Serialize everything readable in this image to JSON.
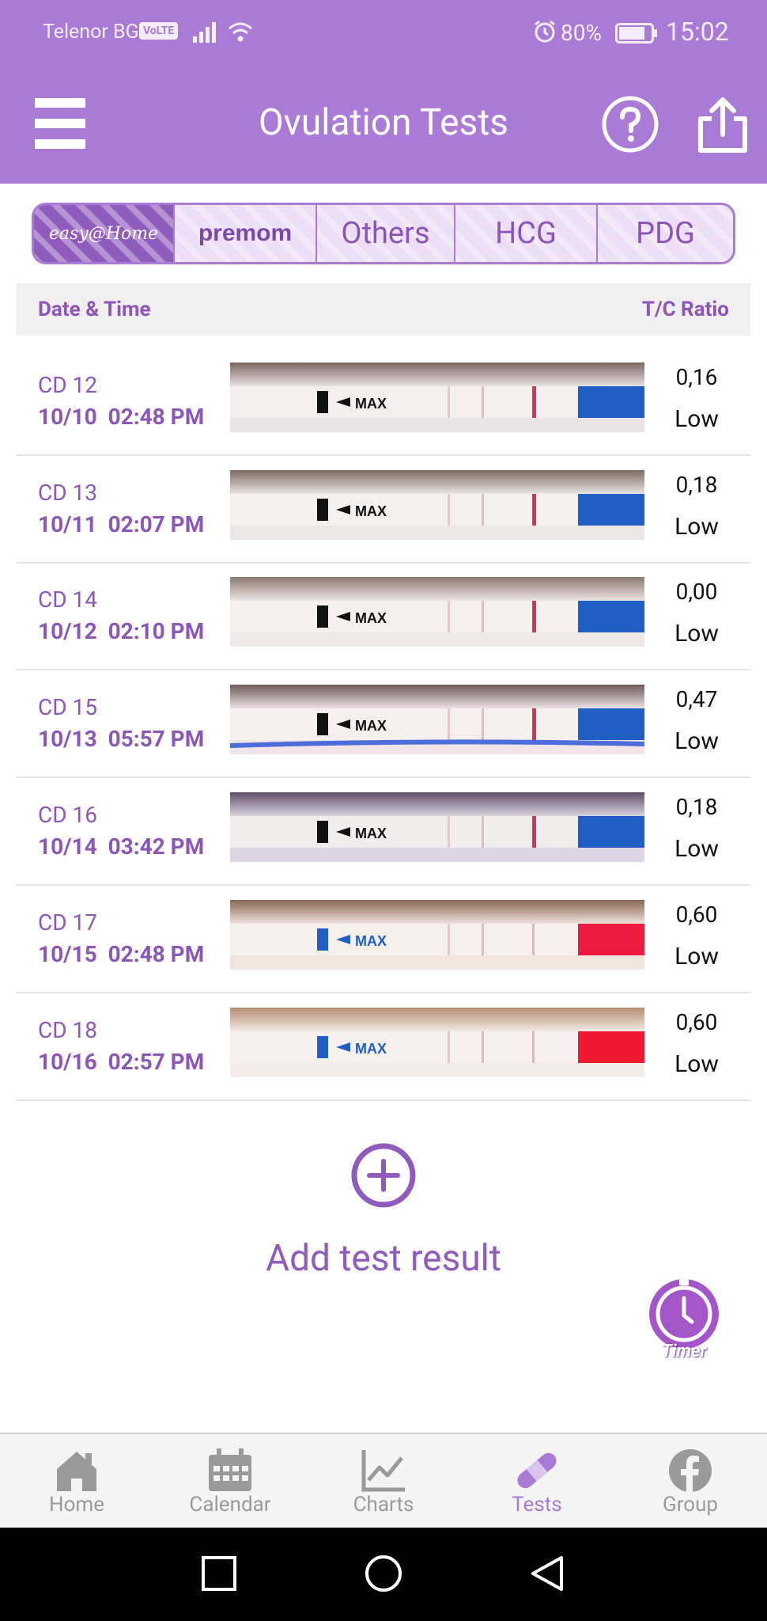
{
  "status_bar": {
    "carrier": "Telenor BG",
    "volte": "VoLTE",
    "battery": "80%",
    "time": "15:02"
  },
  "app_bar": {
    "title": "Ovulation Tests"
  },
  "brand_tabs": [
    {
      "label": "easy@Home",
      "active": true
    },
    {
      "label": "premom",
      "active": false
    },
    {
      "label": "Others",
      "active": false
    },
    {
      "label": "HCG",
      "active": false
    },
    {
      "label": "PDG",
      "active": false
    }
  ],
  "table": {
    "headers": {
      "left": "Date & Time",
      "right": "T/C Ratio"
    },
    "rows": [
      {
        "cd": "CD 12",
        "date": "10/10",
        "time": "02:48 PM",
        "ratio": "0,16",
        "level": "Low"
      },
      {
        "cd": "CD 13",
        "date": "10/11",
        "time": "02:07 PM",
        "ratio": "0,18",
        "level": "Low"
      },
      {
        "cd": "CD 14",
        "date": "10/12",
        "time": "02:10 PM",
        "ratio": "0,00",
        "level": "Low"
      },
      {
        "cd": "CD 15",
        "date": "10/13",
        "time": "05:57 PM",
        "ratio": "0,47",
        "level": "Low"
      },
      {
        "cd": "CD 16",
        "date": "10/14",
        "time": "03:42 PM",
        "ratio": "0,18",
        "level": "Low"
      },
      {
        "cd": "CD 17",
        "date": "10/15",
        "time": "02:48 PM",
        "ratio": "0,60",
        "level": "Low"
      },
      {
        "cd": "CD 18",
        "date": "10/16",
        "time": "02:57 PM",
        "ratio": "0,60",
        "level": "Low"
      }
    ]
  },
  "strip_text": "MAX",
  "add_test": {
    "label": "Add test result"
  },
  "timer": {
    "label": "Timer"
  },
  "bottom_nav": [
    {
      "label": "Home",
      "icon": "home-icon",
      "active": false
    },
    {
      "label": "Calendar",
      "icon": "calendar-icon",
      "active": false
    },
    {
      "label": "Charts",
      "icon": "chart-icon",
      "active": false
    },
    {
      "label": "Tests",
      "icon": "test-strip-icon",
      "active": true
    },
    {
      "label": "Group",
      "icon": "facebook-icon",
      "active": false
    }
  ],
  "colors": {
    "accent": "#a97bd6",
    "accent_dark": "#8f5bbd",
    "text_purple": "#8c55b8"
  }
}
